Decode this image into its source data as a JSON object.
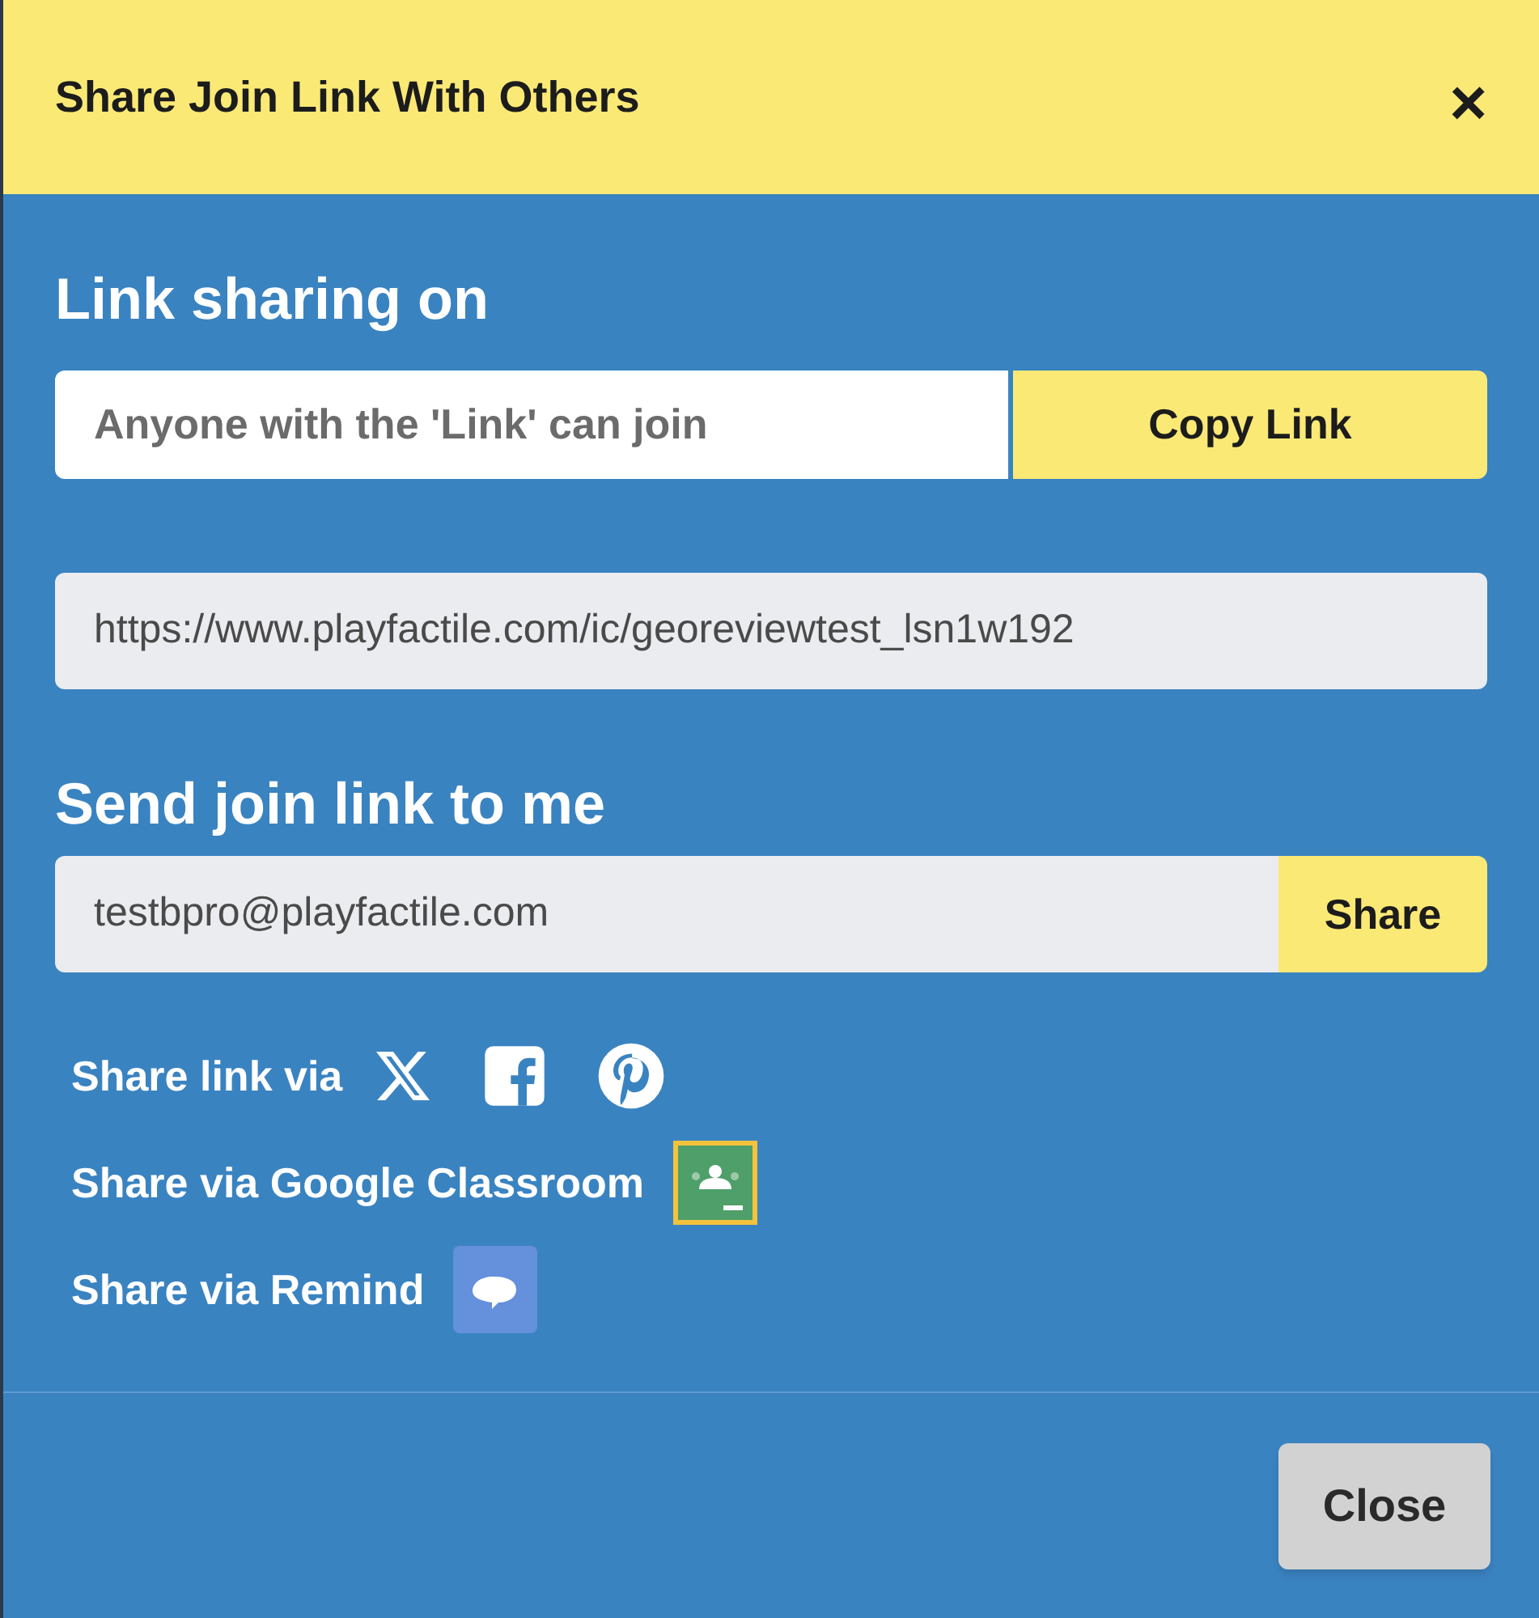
{
  "dialog": {
    "title": "Share Join Link With Others",
    "close_icon": "×"
  },
  "link_sharing": {
    "heading": "Link sharing on",
    "access_value": "Anyone with the 'Link' can join",
    "copy_button": "Copy Link",
    "url": "https://www.playfactile.com/ic/georeviewtest_lsn1w192"
  },
  "send_to_me": {
    "heading": "Send join link to me",
    "email": "testbpro@playfactile.com",
    "share_button": "Share"
  },
  "share_rows": [
    {
      "label": "Share link via",
      "icons": [
        {
          "kind": "x"
        },
        {
          "kind": "facebook"
        },
        {
          "kind": "pinterest"
        }
      ]
    },
    {
      "label": "Share via Google Classroom",
      "icons": [
        {
          "kind": "classroom"
        }
      ]
    },
    {
      "label": "Share via Remind",
      "icons": [
        {
          "kind": "remind"
        }
      ]
    }
  ],
  "footer": {
    "close_button": "Close"
  }
}
